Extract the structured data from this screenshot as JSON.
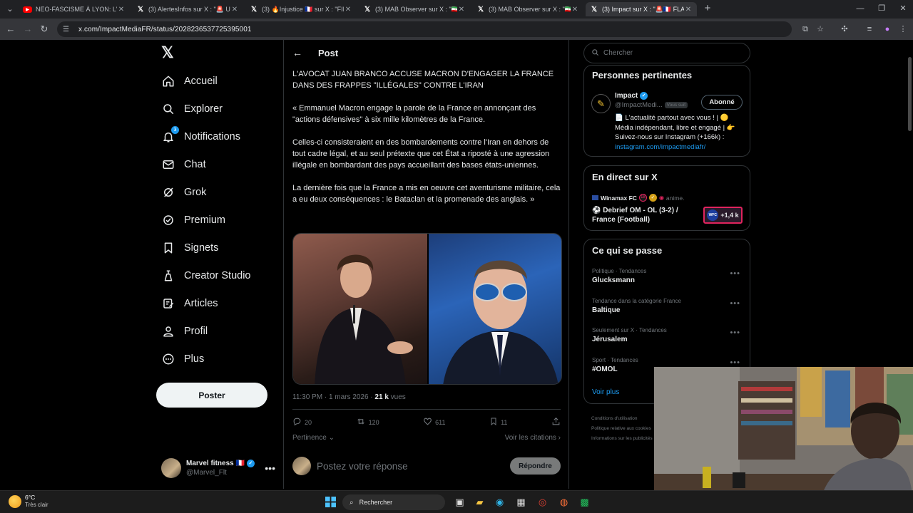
{
  "browser": {
    "tabs": [
      {
        "title": "NEO-FASCISME À LYON: L'IM",
        "icon": "youtube-icon",
        "active": false
      },
      {
        "title": "(3) AlertesInfos sur X : \"🚨 USA",
        "icon": "x-icon",
        "active": false
      },
      {
        "title": "(3) 🔥Injustice 🇫🇷 sur X : \"FIN D",
        "icon": "x-icon",
        "active": false
      },
      {
        "title": "(3) MAB Observer sur X : \"🇮🇷 ✈",
        "icon": "x-icon",
        "active": false
      },
      {
        "title": "(3) MAB Observer sur X : \"🇮🇷 Su",
        "icon": "x-icon",
        "active": false
      },
      {
        "title": "(3) Impact sur X : \"🚨🇫🇷 FLASH",
        "icon": "x-icon",
        "active": true
      }
    ],
    "url": "x.com/ImpactMediaFR/status/2028236537725395001"
  },
  "leftnav": {
    "items": [
      {
        "label": "Accueil",
        "icon": "home-icon"
      },
      {
        "label": "Explorer",
        "icon": "search-icon"
      },
      {
        "label": "Notifications",
        "icon": "bell-icon",
        "badge": "3"
      },
      {
        "label": "Chat",
        "icon": "mail-icon"
      },
      {
        "label": "Grok",
        "icon": "grok-icon"
      },
      {
        "label": "Premium",
        "icon": "premium-icon"
      },
      {
        "label": "Signets",
        "icon": "bookmark-icon"
      },
      {
        "label": "Creator Studio",
        "icon": "creator-studio-icon"
      },
      {
        "label": "Articles",
        "icon": "articles-icon"
      },
      {
        "label": "Profil",
        "icon": "profile-icon"
      },
      {
        "label": "Plus",
        "icon": "more-circle-icon"
      }
    ],
    "post_button": "Poster",
    "account": {
      "name": "Marvel fitness 🇫🇷",
      "handle": "@Marvel_Flt"
    }
  },
  "post": {
    "header": "Post",
    "paragraphs": [
      "L'AVOCAT JUAN BRANCO ACCUSE MACRON D'ENGAGER LA FRANCE DANS DES FRAPPES \"ILLÉGALES\" CONTRE L'IRAN",
      "« Emmanuel Macron engage la parole de la France en annonçant des \"actions défensives\" à six mille kilomètres de la France.",
      "Celles-ci consisteraient en des bombardements contre l'Iran en dehors de tout cadre légal, et au seul prétexte que cet État a riposté à une agression illégale en bombardant des pays accueillant des bases états-uniennes.",
      "La dernière fois que la France a mis en oeuvre cet aventurisme militaire, cela a eu deux conséquences : le Bataclan et la promenade des anglais. »"
    ],
    "time": "11:30 PM · 1 mars 2026 · ",
    "views_count": "21 k",
    "views_label": " vues",
    "stats": {
      "replies": "20",
      "reposts": "120",
      "likes": "611",
      "bookmarks": "11"
    },
    "sort_label": "Pertinence",
    "quotes_link": "Voir les citations",
    "reply_placeholder": "Postez votre réponse",
    "reply_button": "Répondre"
  },
  "sidebar": {
    "search_placeholder": "Chercher",
    "relevant": {
      "title": "Personnes pertinentes",
      "name": "Impact",
      "handle": "@ImpactMedi...",
      "follows_you": "Vous suit",
      "follow_button": "Abonné",
      "bio": "📄 L'actualité partout avec vous ! | 🟡 Média indépendant, libre et engagé | 👉 Suivez-nous sur Instagram (+166k) :",
      "bio_link": "instagram.com/impactmediafr/"
    },
    "live": {
      "title": "En direct sur X",
      "host": "Winamax FC",
      "host_extra": "18",
      "host_status": "anime.",
      "event": "⚽ Debrief OM - OL (3-2) / France (Football)",
      "listeners": "+1,4 k",
      "listeners_logo": "WFC"
    },
    "trends": {
      "title": "Ce qui se passe",
      "items": [
        {
          "category": "Politique · Tendances",
          "name": "Glucksmann"
        },
        {
          "category": "Tendance dans la catégorie France",
          "name": "Baltique"
        },
        {
          "category": "Seulement sur X · Tendances",
          "name": "Jérusalem"
        },
        {
          "category": "Sport · Tendances",
          "name": "#OMOL"
        }
      ],
      "more": "Voir plus"
    },
    "footer": [
      "Conditions d'utilisation",
      "Politique relative aux cookies",
      "Informations sur les publicités"
    ]
  },
  "taskbar": {
    "temperature": "6°C",
    "condition": "Très clair",
    "search_placeholder": "Rechercher"
  },
  "colors": {
    "accent": "#1d9bf0",
    "background": "#000000",
    "border": "#2f3336",
    "muted": "#71767b"
  }
}
